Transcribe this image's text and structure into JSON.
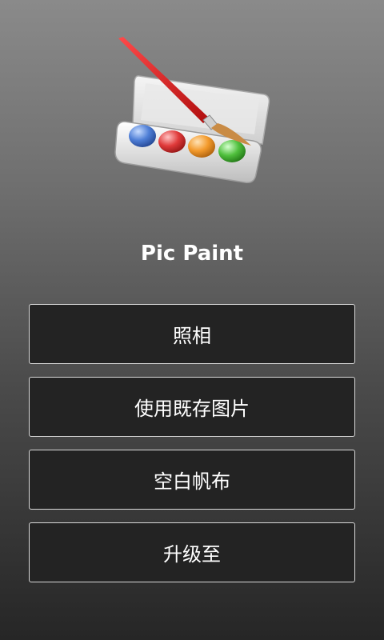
{
  "app": {
    "title": "Pic Paint"
  },
  "logo": {
    "icon": "paint-palette-brush-icon"
  },
  "menu": {
    "items": [
      {
        "label": "照相"
      },
      {
        "label": "使用既存图片"
      },
      {
        "label": "空白帆布"
      },
      {
        "label": "升级至"
      }
    ]
  },
  "colors": {
    "button_background": "#232323",
    "button_border": "#d9d9d9",
    "text": "#ffffff"
  }
}
